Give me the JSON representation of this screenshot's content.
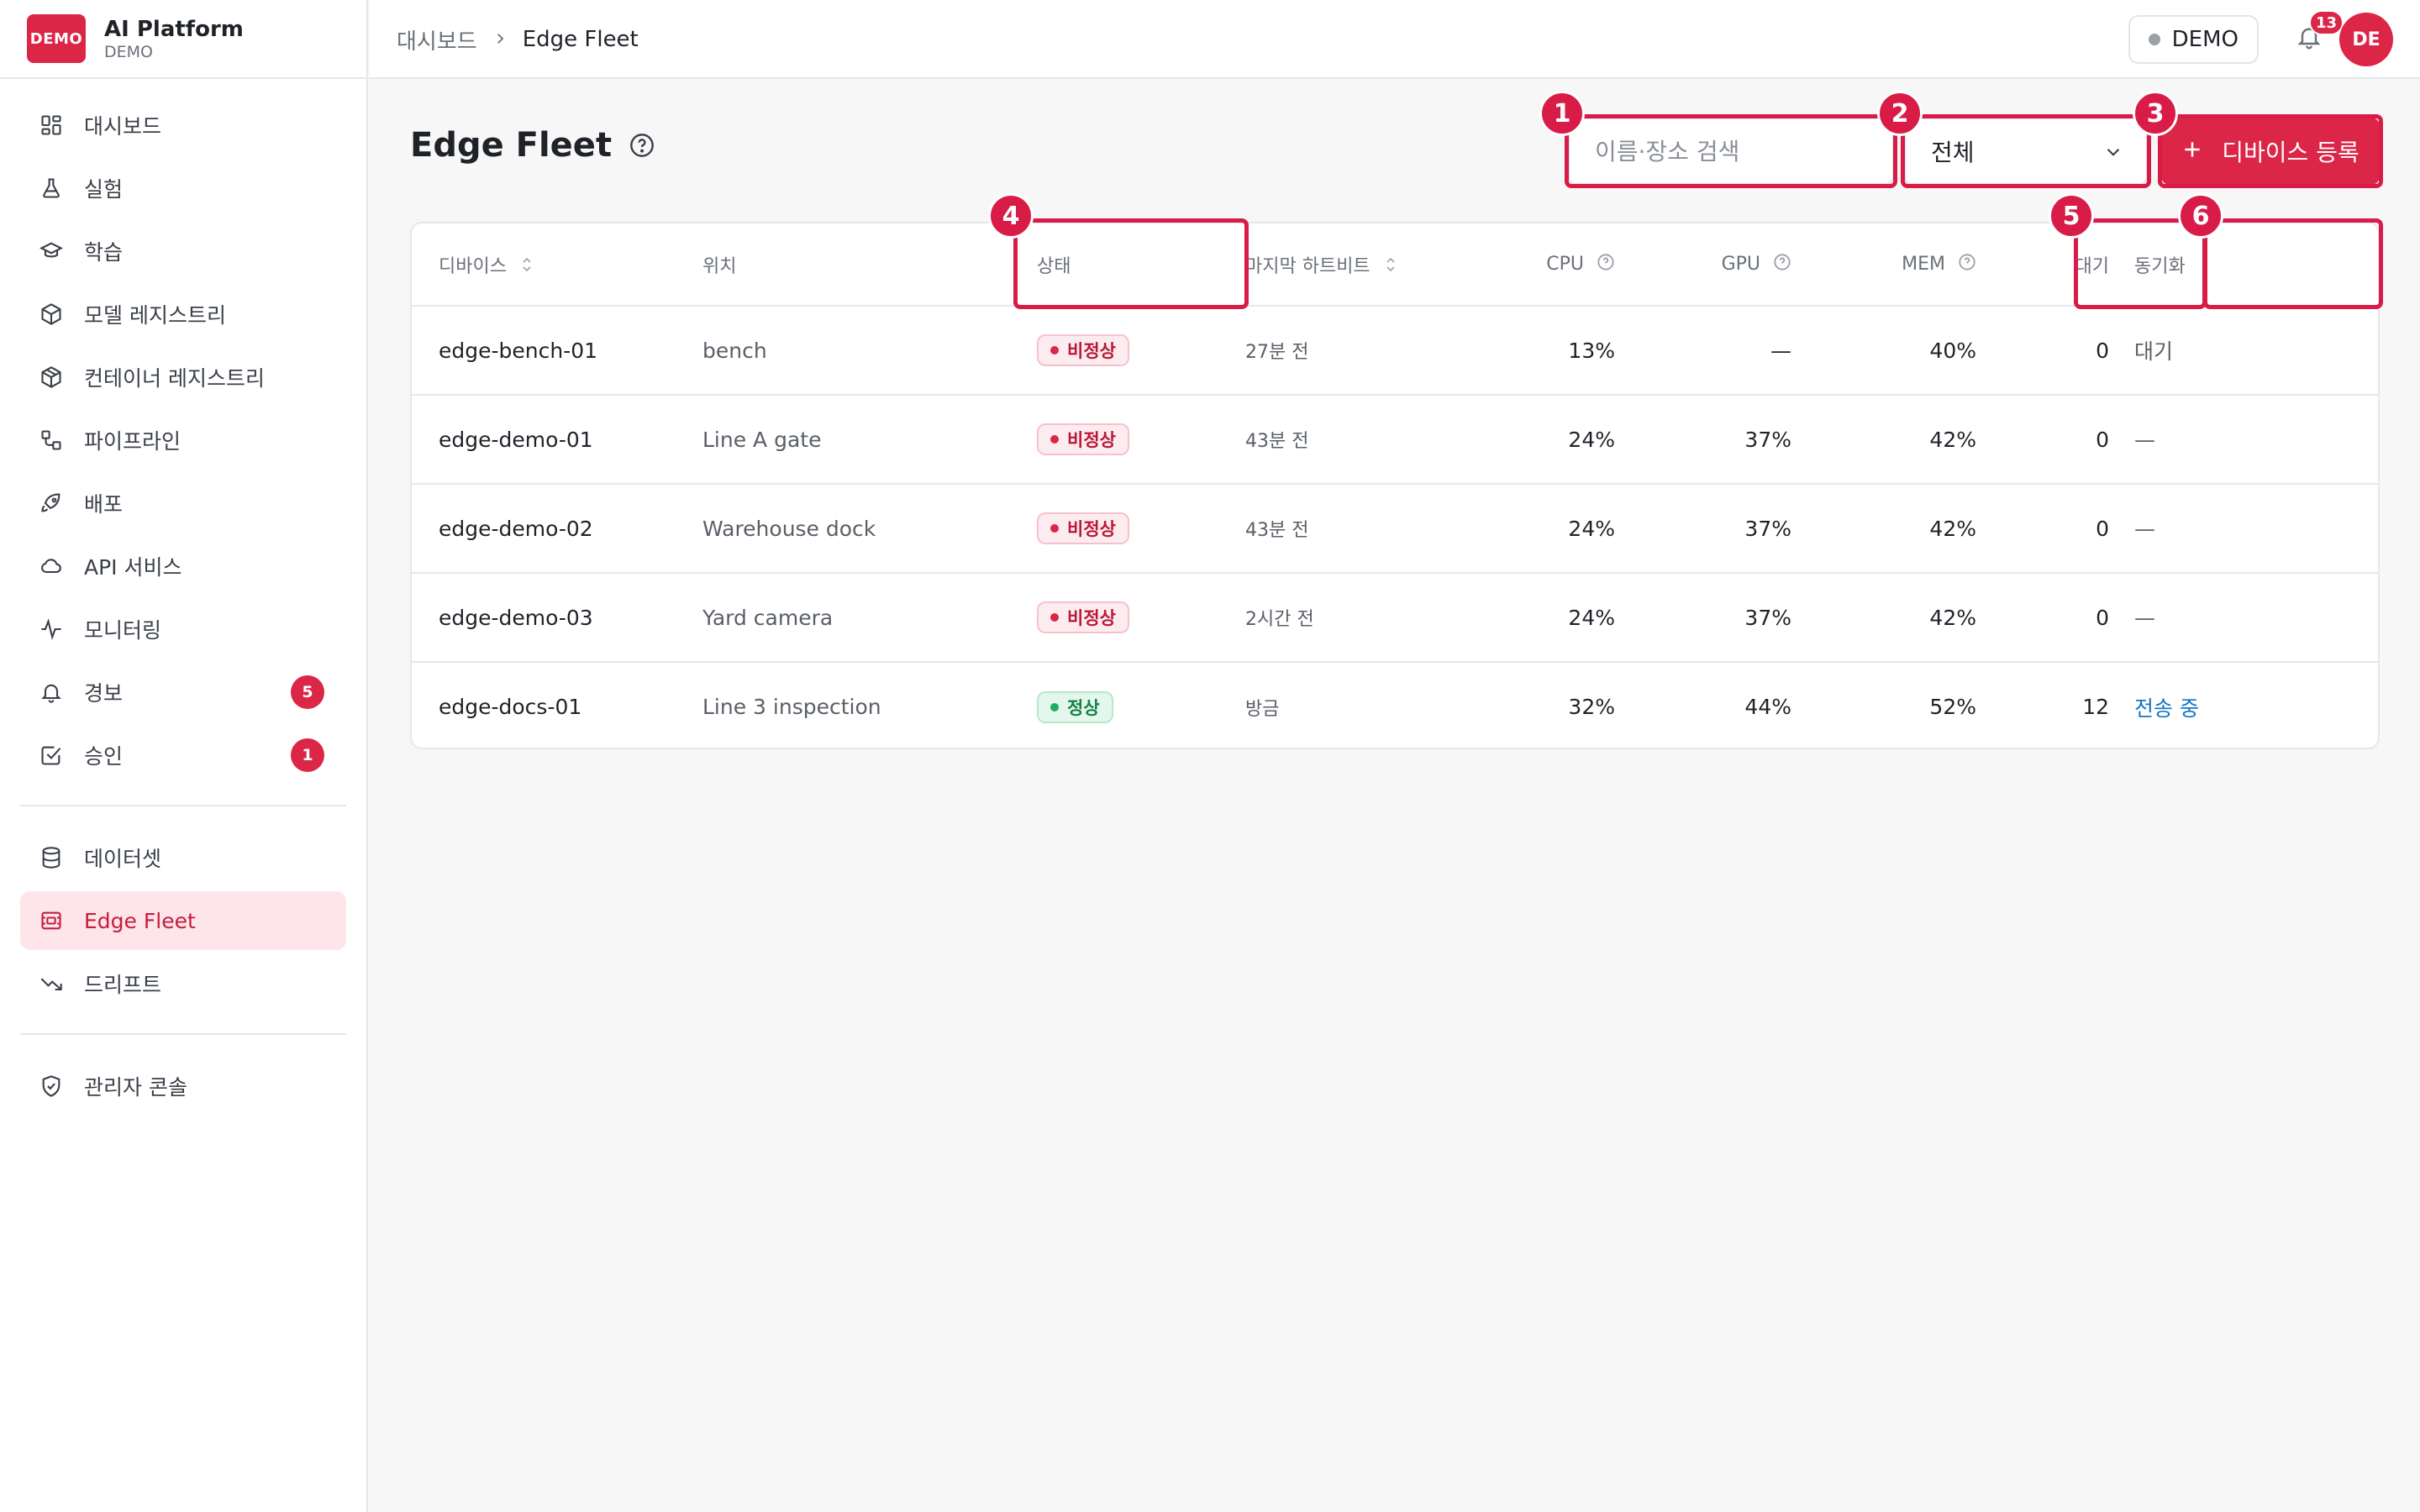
{
  "brand": {
    "logo": "DEMO",
    "title": "AI Platform",
    "subtitle": "DEMO"
  },
  "sidebar": {
    "items": [
      {
        "label": "대시보드",
        "icon": "dashboard-icon"
      },
      {
        "label": "실험",
        "icon": "flask-icon"
      },
      {
        "label": "학습",
        "icon": "graduation-cap-icon"
      },
      {
        "label": "모델 레지스트리",
        "icon": "cube-icon"
      },
      {
        "label": "컨테이너 레지스트리",
        "icon": "package-icon"
      },
      {
        "label": "파이프라인",
        "icon": "workflow-icon"
      },
      {
        "label": "배포",
        "icon": "rocket-icon"
      },
      {
        "label": "API 서비스",
        "icon": "cloud-icon"
      },
      {
        "label": "모니터링",
        "icon": "activity-icon"
      },
      {
        "label": "경보",
        "icon": "bell-icon",
        "badge": "5"
      },
      {
        "label": "승인",
        "icon": "check-square-icon",
        "badge": "1"
      }
    ],
    "items2": [
      {
        "label": "데이터셋",
        "icon": "database-icon"
      },
      {
        "label": "Edge Fleet",
        "icon": "edge-device-icon",
        "active": true
      },
      {
        "label": "드리프트",
        "icon": "trending-down-icon"
      }
    ],
    "items3": [
      {
        "label": "관리자 콘솔",
        "icon": "shield-icon"
      }
    ]
  },
  "topbar": {
    "breadcrumb": {
      "parent": "대시보드",
      "current": "Edge Fleet"
    },
    "env": "DEMO",
    "notifications": "13",
    "avatar": "DE"
  },
  "page": {
    "title": "Edge Fleet",
    "search_placeholder": "이름·장소 검색",
    "filter_value": "전체",
    "add_button": "디바이스 등록"
  },
  "table": {
    "headers": {
      "device": "디바이스",
      "location": "위치",
      "status": "상태",
      "heartbeat": "마지막 하트비트",
      "cpu": "CPU",
      "gpu": "GPU",
      "mem": "MEM",
      "queue": "대기",
      "sync": "동기화"
    },
    "rows": [
      {
        "device": "edge-bench-01",
        "location": "bench",
        "status": "비정상",
        "status_type": "bad",
        "heartbeat": "27분 전",
        "cpu": "13%",
        "gpu": "—",
        "mem": "40%",
        "queue": "0",
        "sync": "대기",
        "sync_type": "muted"
      },
      {
        "device": "edge-demo-01",
        "location": "Line A gate",
        "status": "비정상",
        "status_type": "bad",
        "heartbeat": "43분 전",
        "cpu": "24%",
        "gpu": "37%",
        "mem": "42%",
        "queue": "0",
        "sync": "—",
        "sync_type": "muted"
      },
      {
        "device": "edge-demo-02",
        "location": "Warehouse dock",
        "status": "비정상",
        "status_type": "bad",
        "heartbeat": "43분 전",
        "cpu": "24%",
        "gpu": "37%",
        "mem": "42%",
        "queue": "0",
        "sync": "—",
        "sync_type": "muted"
      },
      {
        "device": "edge-demo-03",
        "location": "Yard camera",
        "status": "비정상",
        "status_type": "bad",
        "heartbeat": "2시간 전",
        "cpu": "24%",
        "gpu": "37%",
        "mem": "42%",
        "queue": "0",
        "sync": "—",
        "sync_type": "muted"
      },
      {
        "device": "edge-docs-01",
        "location": "Line 3 inspection",
        "status": "정상",
        "status_type": "good",
        "heartbeat": "방금",
        "cpu": "32%",
        "gpu": "44%",
        "mem": "52%",
        "queue": "12",
        "sync": "전송 중",
        "sync_type": "link"
      }
    ]
  },
  "annotations": [
    "1",
    "2",
    "3",
    "4",
    "5",
    "6"
  ],
  "colors": {
    "accent": "#dc2648",
    "active_bg": "#fde5ea",
    "link": "#1476c4",
    "ok": "#1fae5f"
  }
}
